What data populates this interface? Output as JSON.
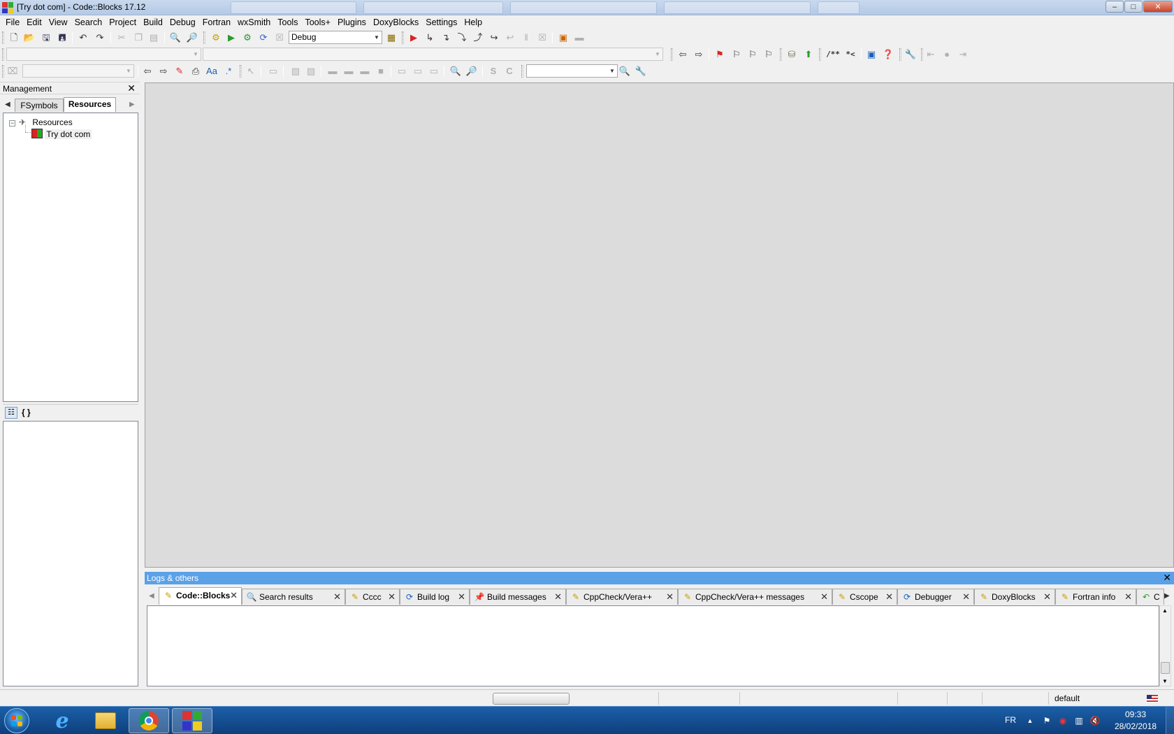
{
  "window": {
    "title": "[Try dot com] - Code::Blocks 17.12",
    "controls": {
      "minimize": "–",
      "maximize": "□",
      "close": "✕"
    }
  },
  "menu": [
    "File",
    "Edit",
    "View",
    "Search",
    "Project",
    "Build",
    "Debug",
    "Fortran",
    "wxSmith",
    "Tools",
    "Tools+",
    "Plugins",
    "DoxyBlocks",
    "Settings",
    "Help"
  ],
  "toolbar": {
    "build_target": "Debug",
    "doxy_block": "/**",
    "doxy_line": "*<"
  },
  "management": {
    "title": "Management",
    "tabs": [
      "FSymbols",
      "Resources"
    ],
    "active_tab": "Resources",
    "tree": {
      "root": "Resources",
      "children": [
        "Try dot com"
      ]
    },
    "symbols_button": "{ }"
  },
  "logs": {
    "title": "Logs & others",
    "tabs": [
      {
        "label": "Code::Blocks",
        "icon": "pencil-icon",
        "active": true
      },
      {
        "label": "Search results",
        "icon": "magnifier-icon"
      },
      {
        "label": "Cccc",
        "icon": "pencil-icon"
      },
      {
        "label": "Build log",
        "icon": "gear-cycle-icon"
      },
      {
        "label": "Build messages",
        "icon": "pushpin-icon"
      },
      {
        "label": "CppCheck/Vera++",
        "icon": "pencil-icon"
      },
      {
        "label": "CppCheck/Vera++ messages",
        "icon": "pencil-icon"
      },
      {
        "label": "Cscope",
        "icon": "pencil-icon"
      },
      {
        "label": "Debugger",
        "icon": "gear-cycle-icon"
      },
      {
        "label": "DoxyBlocks",
        "icon": "pencil-icon"
      },
      {
        "label": "Fortran info",
        "icon": "pencil-icon"
      },
      {
        "label": "C",
        "icon": "arrow-icon"
      }
    ]
  },
  "statusbar": {
    "status": "default"
  },
  "taskbar": {
    "language": "FR",
    "time": "09:33",
    "date": "28/02/2018"
  },
  "colors": {
    "editor_background": "#dcdcdc",
    "logs_header": "#5aa1e8",
    "taskbar": "#1b5fa8"
  }
}
